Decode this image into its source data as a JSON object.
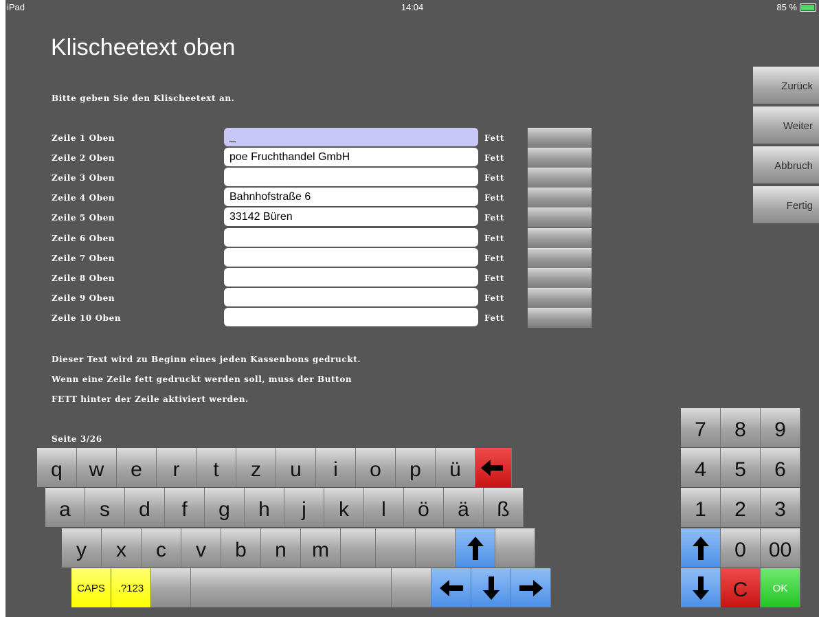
{
  "status_bar": {
    "device": "iPad",
    "time": "14:04",
    "battery": "85 %",
    "battery_level": 0.85
  },
  "page": {
    "title": "Klischeetext oben",
    "instruction": "Bitte geben Sie den Klischeetext an.",
    "fett_label": "Fett",
    "rows": [
      {
        "label": "Zeile 1 Oben",
        "value": "_"
      },
      {
        "label": "Zeile 2 Oben",
        "value": "poe Fruchthandel GmbH"
      },
      {
        "label": "Zeile 3 Oben",
        "value": ""
      },
      {
        "label": "Zeile 4 Oben",
        "value": "Bahnhofstraße 6"
      },
      {
        "label": "Zeile 5 Oben",
        "value": "33142 Büren"
      },
      {
        "label": "Zeile 6 Oben",
        "value": ""
      },
      {
        "label": "Zeile 7 Oben",
        "value": ""
      },
      {
        "label": "Zeile 8 Oben",
        "value": ""
      },
      {
        "label": "Zeile 9 Oben",
        "value": ""
      },
      {
        "label": "Zeile 10 Oben",
        "value": ""
      }
    ],
    "info_lines": [
      "Dieser Text wird zu Beginn eines jeden Kassenbons gedruckt.",
      "Wenn eine Zeile fett gedruckt werden soll, muss der Button",
      "FETT hinter der Zeile aktiviert werden."
    ],
    "page_indicator": "Seite 3/26"
  },
  "sidebar": {
    "back": "Zurück",
    "next": "Weiter",
    "cancel": "Abbruch",
    "done": "Fertig"
  },
  "keyboard": {
    "row1": [
      "q",
      "w",
      "e",
      "r",
      "t",
      "z",
      "u",
      "i",
      "o",
      "p",
      "ü"
    ],
    "row2": [
      "a",
      "s",
      "d",
      "f",
      "g",
      "h",
      "j",
      "k",
      "l",
      "ö",
      "ä",
      "ß"
    ],
    "row3": [
      "y",
      "x",
      "c",
      "v",
      "b",
      "n",
      "m"
    ],
    "caps": "CAPS",
    "symbols": ".?123"
  },
  "numpad": {
    "row1": [
      "7",
      "8",
      "9"
    ],
    "row2": [
      "4",
      "5",
      "6"
    ],
    "row3": [
      "1",
      "2",
      "3"
    ],
    "zero": "0",
    "double_zero": "00",
    "clear": "C",
    "ok": "OK"
  },
  "icons": {
    "backspace": "left-arrow-icon",
    "shift": "up-arrow-icon",
    "cursor_left": "left-arrow-icon",
    "cursor_down": "down-arrow-icon",
    "cursor_right": "right-arrow-icon",
    "numpad_up": "up-arrow-icon",
    "numpad_down": "down-arrow-icon"
  },
  "colors": {
    "background": "#565656",
    "active_field": "#c8c8f8",
    "caps_key": "#ffff00",
    "backspace_key": "#d11f1f",
    "arrow_key": "#5b9aea",
    "ok_key": "#22c522"
  }
}
